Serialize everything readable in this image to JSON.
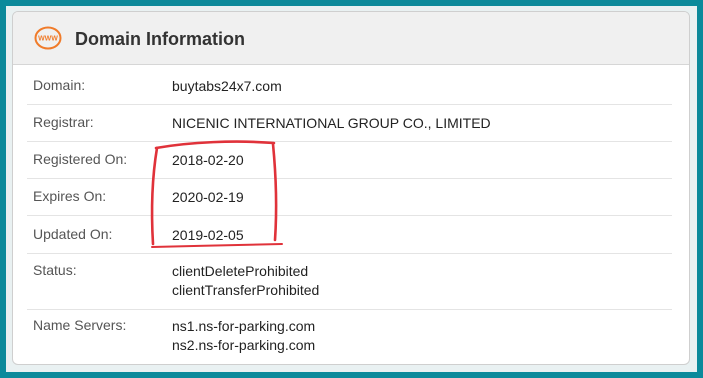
{
  "header": {
    "title": "Domain Information",
    "icon": "www-icon",
    "icon_text": "WWW",
    "icon_color": "#f07b2a"
  },
  "rows": [
    {
      "label": "Domain:",
      "values": [
        "buytabs24x7.com"
      ]
    },
    {
      "label": "Registrar:",
      "values": [
        "NICENIC INTERNATIONAL GROUP CO., LIMITED"
      ]
    },
    {
      "label": "Registered On:",
      "values": [
        "2018-02-20"
      ]
    },
    {
      "label": "Expires On:",
      "values": [
        "2020-02-19"
      ]
    },
    {
      "label": "Updated On:",
      "values": [
        "2019-02-05"
      ]
    },
    {
      "label": "Status:",
      "values": [
        "clientDeleteProhibited",
        "clientTransferProhibited"
      ]
    },
    {
      "label": "Name Servers:",
      "values": [
        "ns1.ns-for-parking.com",
        "ns2.ns-for-parking.com"
      ]
    }
  ],
  "colors": {
    "frame": "#0b8a9b",
    "highlight": "#e0323a"
  }
}
